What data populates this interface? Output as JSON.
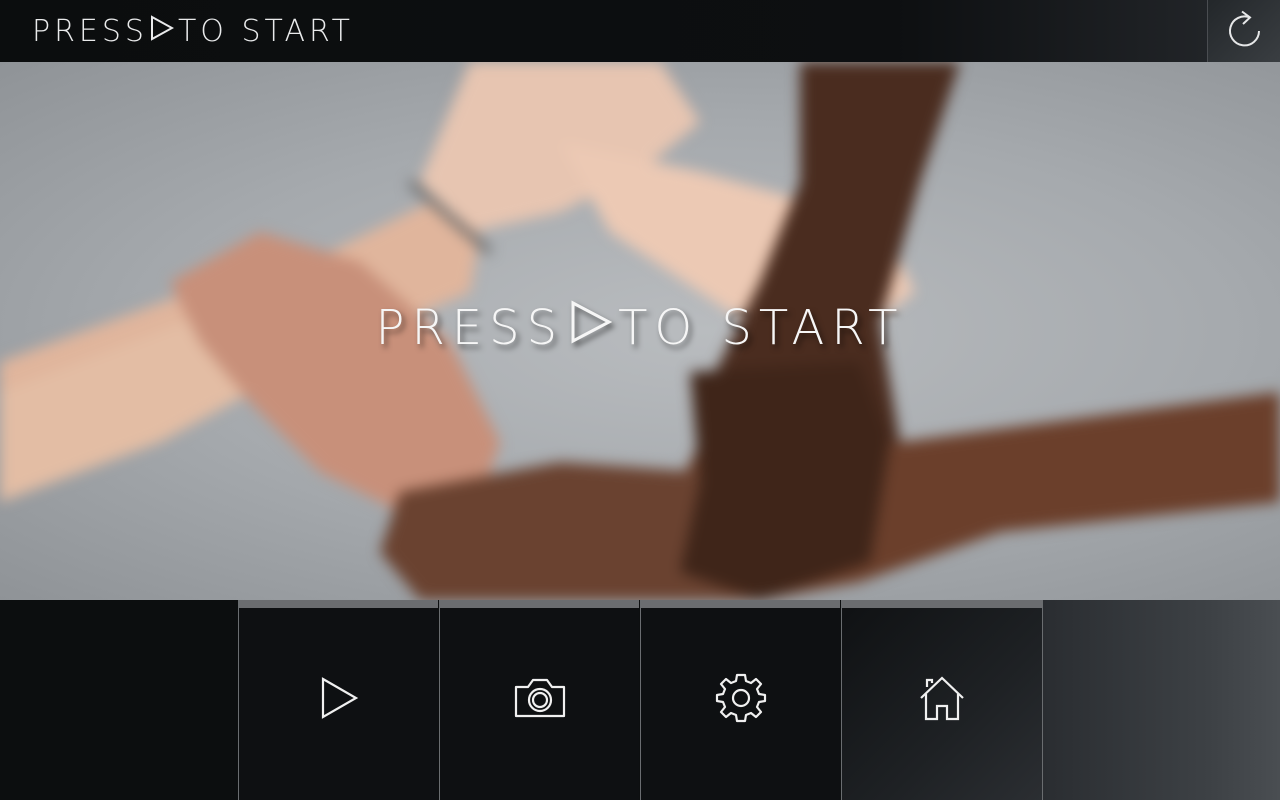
{
  "topbar": {
    "title_before": "PRESS",
    "title_after": "TO START",
    "play_icon": "play-outline-icon",
    "refresh_icon": "refresh-icon"
  },
  "hero": {
    "text_before": "PRESS",
    "text_after": "TO START",
    "play_icon": "play-outline-icon",
    "image_description_icon": "hands-photo"
  },
  "bottom_nav": {
    "buttons": [
      {
        "id": "play",
        "icon": "play-icon"
      },
      {
        "id": "camera",
        "icon": "camera-icon"
      },
      {
        "id": "settings",
        "icon": "gear-icon"
      },
      {
        "id": "home",
        "icon": "home-icon"
      }
    ]
  },
  "colors": {
    "bar_dark": "#0d0f10",
    "accent_gray": "#6b6d70",
    "text": "#e9eaeb"
  }
}
